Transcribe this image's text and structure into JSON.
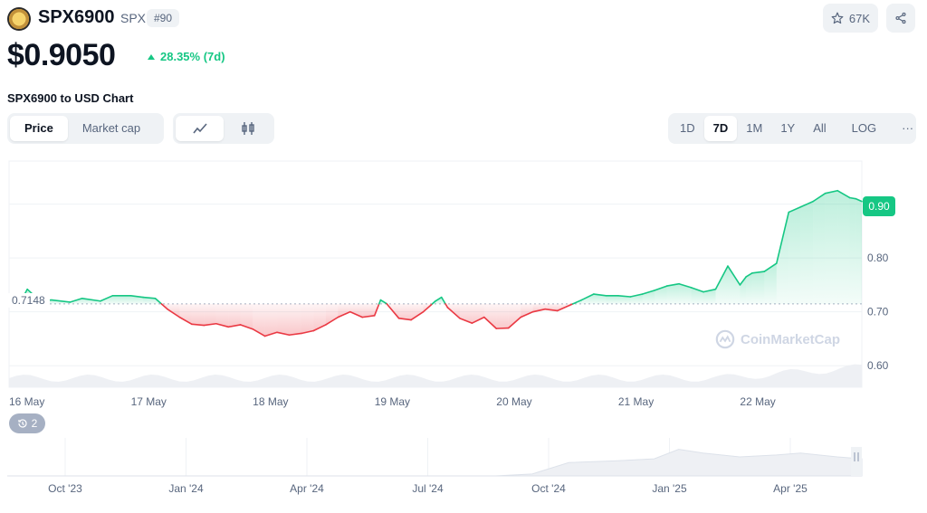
{
  "header": {
    "coin_name": "SPX6900",
    "symbol": "SPX",
    "rank": "#90",
    "watchlist_count": "67K",
    "price": "$0.9050",
    "change": "28.35% (7d)"
  },
  "chart_section": {
    "title": "SPX6900 to USD Chart",
    "metric_tabs": [
      {
        "label": "Price",
        "active": true
      },
      {
        "label": "Market cap",
        "active": false
      }
    ],
    "style_icons": [
      "line-chart-icon",
      "candlestick-icon"
    ],
    "range_tabs": [
      {
        "label": "1D",
        "active": false
      },
      {
        "label": "7D",
        "active": true
      },
      {
        "label": "1M",
        "active": false
      },
      {
        "label": "1Y",
        "active": false
      },
      {
        "label": "All",
        "active": false
      },
      {
        "label": "LOG",
        "active": false
      }
    ],
    "more": "···",
    "current_price_tag": "0.90",
    "baseline_tag": "0.7148",
    "events_count": "2",
    "watermark": "CoinMarketCap"
  },
  "colors": {
    "up": "#16c784",
    "down": "#ea3943",
    "text": "#0d1421",
    "muted": "#58667e",
    "button_bg": "#eff2f5"
  },
  "chart_data": {
    "type": "line",
    "baseline": 0.7148,
    "ylim": [
      0.56,
      0.98
    ],
    "yticks": [
      0.6,
      0.7,
      0.8,
      0.9
    ],
    "ytick_labels": [
      "0.60",
      "0.70",
      "0.80",
      "0.90"
    ],
    "xticks": [
      0,
      1,
      2,
      3,
      4,
      5,
      6
    ],
    "xtick_labels": [
      "16 May",
      "17 May",
      "18 May",
      "19 May",
      "20 May",
      "21 May",
      "22 May"
    ],
    "xlim": [
      0,
      7
    ],
    "series": [
      {
        "x": [
          0,
          0.1,
          0.15,
          0.25,
          0.35,
          0.5,
          0.6,
          0.75,
          0.85,
          1,
          1.1,
          1.2,
          1.3,
          1.4,
          1.5,
          1.6,
          1.7,
          1.8,
          1.9,
          2,
          2.1,
          2.2,
          2.3,
          2.4,
          2.5,
          2.6,
          2.7,
          2.8,
          2.9,
          3,
          3.05,
          3.1,
          3.2,
          3.3,
          3.4,
          3.5,
          3.55,
          3.6,
          3.7,
          3.8,
          3.9,
          4,
          4.1,
          4.2,
          4.3,
          4.4,
          4.5,
          4.6,
          4.7,
          4.8,
          4.9,
          5,
          5.1,
          5.2,
          5.3,
          5.4,
          5.5,
          5.6,
          5.7,
          5.8,
          5.9,
          6,
          6.05,
          6.1,
          6.2,
          6.3,
          6.4,
          6.5,
          6.6,
          6.7,
          6.8,
          6.9,
          6.95,
          7
        ],
        "y": [
          0.721,
          0.721,
          0.742,
          0.721,
          0.722,
          0.718,
          0.725,
          0.72,
          0.73,
          0.73,
          0.727,
          0.725,
          0.705,
          0.69,
          0.677,
          0.675,
          0.678,
          0.672,
          0.676,
          0.668,
          0.655,
          0.662,
          0.657,
          0.66,
          0.665,
          0.676,
          0.69,
          0.7,
          0.69,
          0.693,
          0.722,
          0.715,
          0.688,
          0.685,
          0.7,
          0.72,
          0.727,
          0.708,
          0.688,
          0.679,
          0.69,
          0.669,
          0.67,
          0.69,
          0.7,
          0.705,
          0.702,
          0.712,
          0.722,
          0.733,
          0.73,
          0.73,
          0.728,
          0.733,
          0.74,
          0.748,
          0.752,
          0.745,
          0.737,
          0.742,
          0.785,
          0.75,
          0.765,
          0.772,
          0.775,
          0.79,
          0.885,
          0.895,
          0.905,
          0.92,
          0.925,
          0.912,
          0.91,
          0.905
        ]
      }
    ],
    "volume_label": "",
    "navigator": {
      "type": "area",
      "xtick_labels": [
        "Oct '23",
        "Jan '24",
        "Apr '24",
        "Jul '24",
        "Oct '24",
        "Jan '25",
        "Apr '25"
      ],
      "x": [
        0,
        0.5,
        1,
        1.5,
        2,
        2.5,
        3,
        3.5,
        4,
        4.3,
        4.6,
        5,
        5.3,
        5.5,
        5.7,
        6,
        6.3,
        6.5,
        6.8,
        7
      ],
      "y": [
        0,
        0,
        0,
        0,
        0,
        0,
        0,
        0,
        0,
        0.05,
        0.35,
        0.4,
        0.45,
        0.7,
        0.6,
        0.5,
        0.55,
        0.6,
        0.5,
        0.45
      ]
    }
  }
}
